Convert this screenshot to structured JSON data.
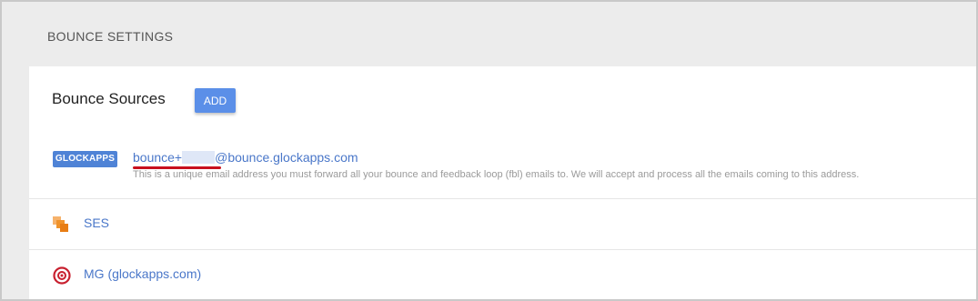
{
  "section": {
    "title": "BOUNCE SETTINGS"
  },
  "bounce_sources": {
    "title": "Bounce Sources",
    "add_label": "ADD",
    "primary": {
      "badge": "GLOCKAPPS",
      "email_prefix": "bounce+",
      "email_suffix": "@bounce.glockapps.com",
      "description": "This is a unique email address you must forward all your bounce and feedback loop (fbl) emails to. We will accept and process all the emails coming to this address."
    },
    "sources": [
      {
        "label": "SES",
        "icon": "aws-ses-icon",
        "color": "#f0932b"
      },
      {
        "label": "MG (glockapps.com)",
        "icon": "mailgun-icon",
        "color": "#c8202f"
      }
    ]
  },
  "colors": {
    "accent": "#5b8fe8",
    "badge": "#4f83d6",
    "link": "#4a77c9",
    "annotation_underline": "#c8101e"
  }
}
